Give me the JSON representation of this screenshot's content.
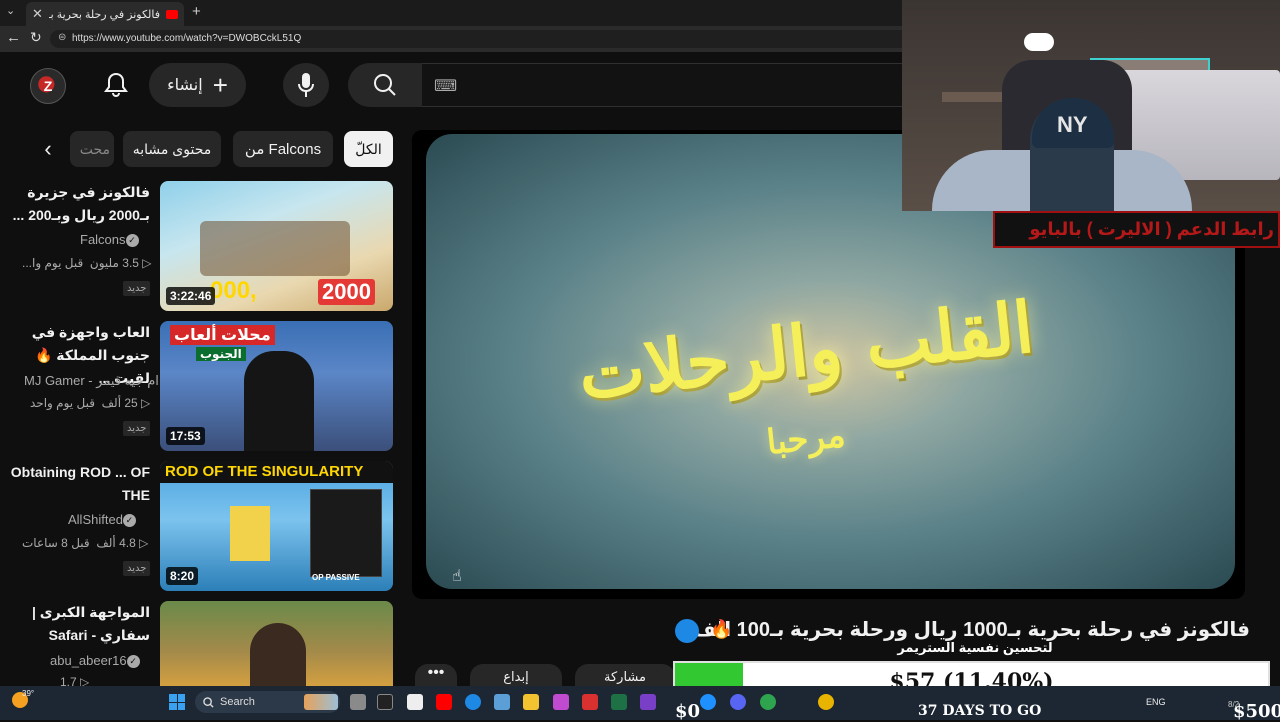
{
  "browser": {
    "tab_title": "فالكونز في رحلة بحرية بـ1000 ريال و",
    "tab_close": "✕",
    "tab_menu": "⌄",
    "new_tab": "+",
    "url": "https://www.youtube.com/watch?v=DWOBCckL51Q",
    "back_icon": "←",
    "reload_icon": "↻",
    "lock_icon": "⊜"
  },
  "header": {
    "avatar_text": "Z",
    "create_label": "إنشاء",
    "create_icon": "+",
    "keyboard_icon": "⌨"
  },
  "chips": {
    "all": "الكلّ",
    "from": "من Falcons",
    "related": "محتوى مشابه",
    "partial": "محت",
    "next_icon": "‹"
  },
  "videos": [
    {
      "title": "فالكونز في جزيرة بـ2000 ريال وبـ200 ...",
      "channel": "Falcons",
      "verified": true,
      "views": "3.5 مليون",
      "age": "قبل يوم وا...",
      "badge": "جديد",
      "duration": "3:22:46",
      "thumb_text_left": "000,",
      "thumb_text_right": "2000"
    },
    {
      "title": "العاب واجهزة في جنوب المملكة 🔥 لقيت ...",
      "channel": "MJ Gamer - ام جيه قيمر",
      "verified": false,
      "views": "25 ألف",
      "age": "قبل يوم واحد",
      "badge": "جديد",
      "duration": "17:53",
      "thumb_text_left": "محلات ألعاب",
      "thumb_text_right": "الجنوب"
    },
    {
      "title": "Obtaining ROD ... OF THE",
      "channel": "AllShifted",
      "verified": true,
      "views": "4.8 ألف",
      "age": "قبل 8 ساعات",
      "badge": "جديد",
      "duration": "8:20",
      "thumb_text_left": "ROD OF THE SINGULARITY",
      "thumb_text_right": "OP PASSIVE"
    },
    {
      "title": "المواجهة الكبرى | سفاري - Safari",
      "channel": "abu_abeer16",
      "verified": true,
      "views": "1.7",
      "age": "",
      "badge": "",
      "duration": "",
      "thumb_text_left": "",
      "thumb_text_right": ""
    }
  ],
  "player": {
    "logo_main": "القلب والرحلات",
    "logo_sub": "مرحبا"
  },
  "video": {
    "title": "فالكونز في رحلة بحرية بـ1000 ريال ورحلة بحرية بـ100 الف ريال",
    "fire_icon": "🔥",
    "action_share": "مشاركة",
    "action_save": "إبداع",
    "action_more": "•••"
  },
  "stream": {
    "support_banner": "رابط الدعم ( الاليرت ) بالبايو",
    "goal_subtitle": "لتحسين نفسية الستريمر",
    "goal_text": "$57 (11.40%)",
    "goal_fraction": 0.114,
    "goal_min": "$0",
    "goal_max": "$500",
    "days_to_go": "37 DAYS TO GO",
    "cap_logo": "NY"
  },
  "taskbar": {
    "search_label": "Search",
    "weather_temp": "39°",
    "lang": "ENG",
    "date": "8/2"
  },
  "colors": {
    "youtube_red": "#ff0000",
    "goal_green": "#32c832",
    "banner_red": "#b51818"
  }
}
